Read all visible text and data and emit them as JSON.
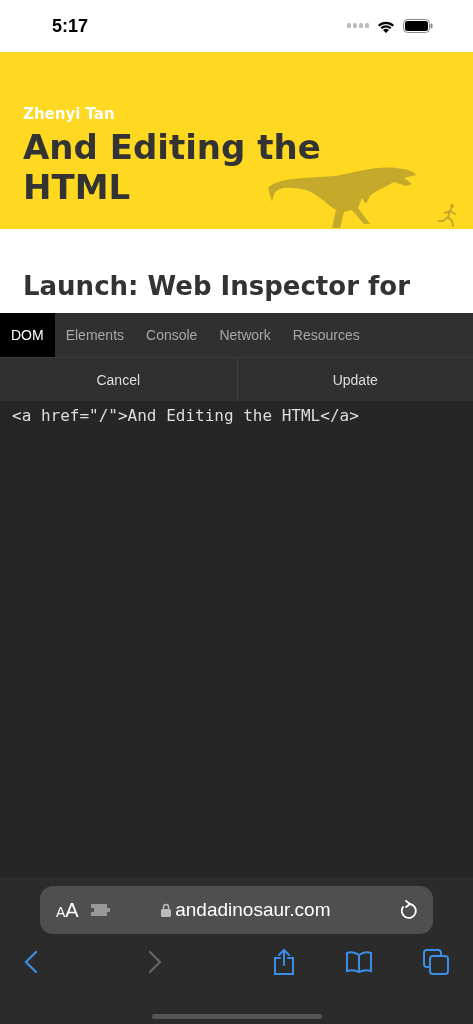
{
  "status_bar": {
    "time": "5:17"
  },
  "banner": {
    "author": "Zhenyi Tan",
    "title": "And Editing the HTML"
  },
  "article": {
    "heading": "Launch: Web Inspector for"
  },
  "inspector": {
    "tabs": [
      {
        "label": "DOM",
        "selected": true
      },
      {
        "label": "Elements",
        "selected": false
      },
      {
        "label": "Console",
        "selected": false
      },
      {
        "label": "Network",
        "selected": false
      },
      {
        "label": "Resources",
        "selected": false
      }
    ],
    "buttons": [
      "Cancel",
      "Update"
    ],
    "editor": {
      "value": "<a href=\"/\">And Editing the HTML</a>"
    }
  },
  "address_bar": {
    "text_size": "AA",
    "url": "andadinosaur.com"
  }
}
